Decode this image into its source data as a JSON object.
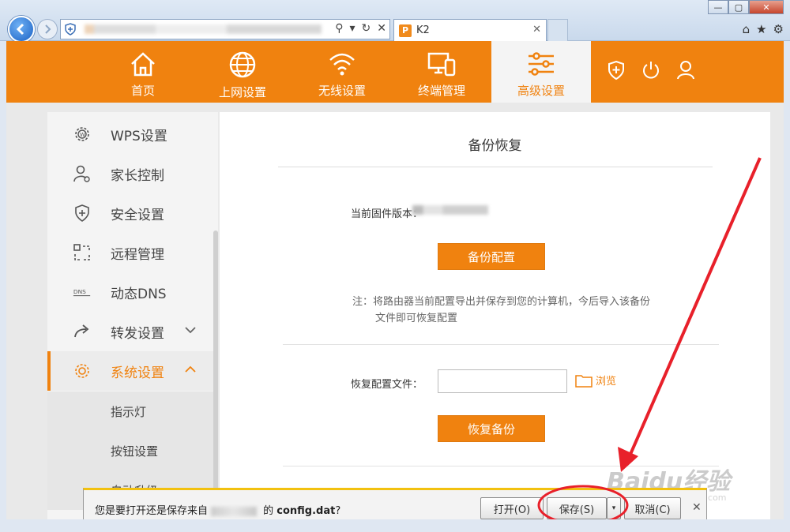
{
  "browser": {
    "tab_title": "K2",
    "tab_icon": "P"
  },
  "router_nav": {
    "items": [
      {
        "label": "首页",
        "icon": "home-icon"
      },
      {
        "label": "上网设置",
        "icon": "globe-icon"
      },
      {
        "label": "无线设置",
        "icon": "wifi-icon"
      },
      {
        "label": "终端管理",
        "icon": "devices-icon"
      },
      {
        "label": "高级设置",
        "icon": "sliders-icon",
        "active": true
      }
    ],
    "accent": "#f0820f"
  },
  "sidebar": {
    "items": [
      {
        "label": "WPS设置",
        "icon": "wps-gear-icon"
      },
      {
        "label": "家长控制",
        "icon": "parent-user-icon"
      },
      {
        "label": "安全设置",
        "icon": "shield-icon"
      },
      {
        "label": "远程管理",
        "icon": "remote-icon"
      },
      {
        "label": "动态DNS",
        "icon": "dns-icon"
      },
      {
        "label": "转发设置",
        "icon": "forward-icon"
      },
      {
        "label": "系统设置",
        "icon": "system-gear-icon"
      }
    ],
    "subitems": [
      "指示灯",
      "按钮设置",
      "自动升级"
    ]
  },
  "content": {
    "title": "备份恢复",
    "firmware_label": "当前固件版本：",
    "backup_button": "备份配置",
    "note_line1": "注：将路由器当前配置导出并保存到您的计算机，今后导入该备份",
    "note_line2": "文件即可恢复配置",
    "restore_label": "恢复配置文件：",
    "browse_label": "浏览",
    "restore_button": "恢复备份"
  },
  "download_bar": {
    "prefix": "您是要打开还是保存来自",
    "middle": " 的 ",
    "filename": "config.dat",
    "suffix": "?",
    "open_button": "打开(O)",
    "save_button": "保存(S)",
    "cancel_button": "取消(C)"
  },
  "watermark": {
    "text": "Baidu经验",
    "sub": "jingyan.baidu.com"
  }
}
